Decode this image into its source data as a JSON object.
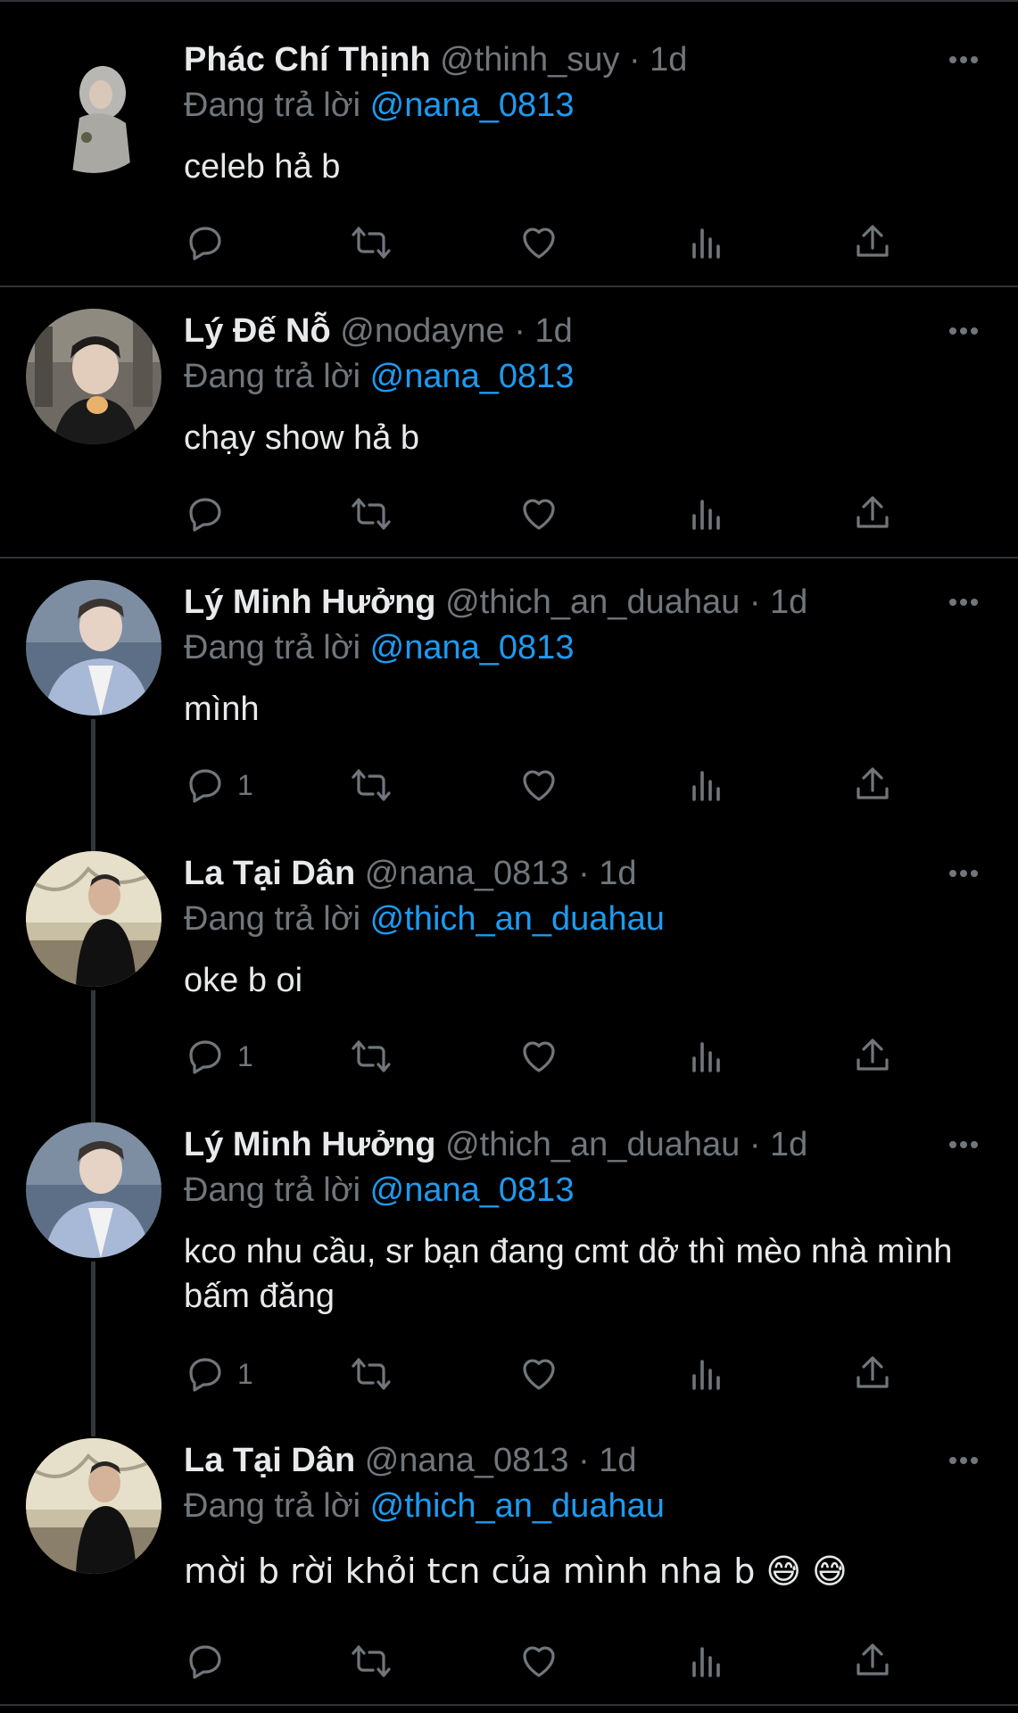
{
  "reply_prefix": "Đang trả lời",
  "tweets": [
    {
      "name": "Phác Chí Thịnh",
      "handle": "@thinh_suy",
      "time": "1d",
      "reply_to": "@nana_0813",
      "text": "celeb hả b",
      "reply_count": ""
    },
    {
      "name": "Lý Đế Nỗ",
      "handle": "@nodayne",
      "time": "1d",
      "reply_to": "@nana_0813",
      "text": "chạy show hả b",
      "reply_count": ""
    },
    {
      "name": "Lý Minh Hưởng",
      "handle": "@thich_an_duahau",
      "time": "1d",
      "reply_to": "@nana_0813",
      "text": "mình",
      "reply_count": "1"
    },
    {
      "name": "La Tại Dân",
      "handle": "@nana_0813",
      "time": "1d",
      "reply_to": "@thich_an_duahau",
      "text": "oke b oi",
      "reply_count": "1"
    },
    {
      "name": "Lý Minh Hưởng",
      "handle": "@thich_an_duahau",
      "time": "1d",
      "reply_to": "@nana_0813",
      "text": "kco nhu cầu, sr bạn đang cmt dở thì mèo nhà mình bấm đăng",
      "reply_count": "1"
    },
    {
      "name": "La Tại Dân",
      "handle": "@nana_0813",
      "time": "1d",
      "reply_to": "@thich_an_duahau",
      "text": "mời b rời khỏi tcn của mình nha b 😅 😅",
      "reply_count": ""
    }
  ],
  "colors": {
    "background": "#000000",
    "text": "#e7e9ea",
    "muted": "#71767b",
    "accent": "#1d9bf0",
    "divider": "#2f3336"
  },
  "icons": {
    "reply": "reply-icon",
    "retweet": "retweet-icon",
    "like": "heart-icon",
    "views": "views-icon",
    "share": "share-icon",
    "more": "more-icon"
  }
}
